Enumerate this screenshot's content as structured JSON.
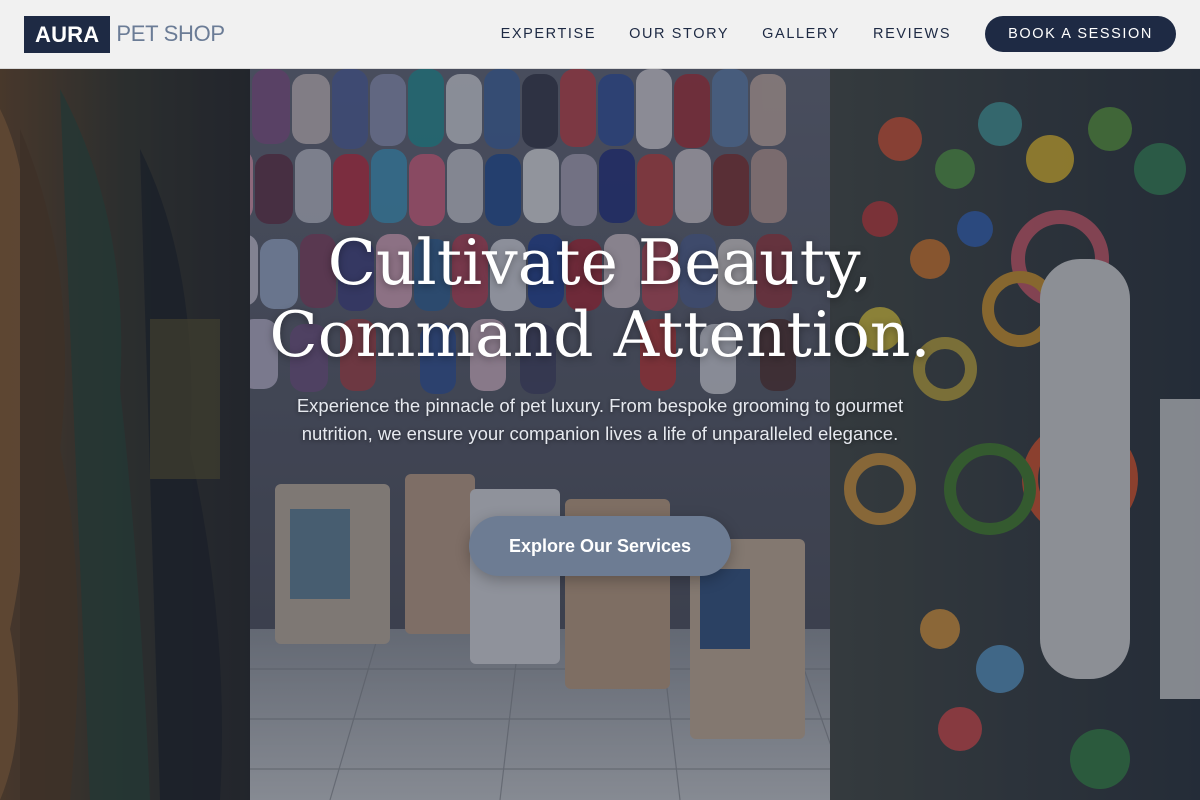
{
  "brand": {
    "box_text": "AURA",
    "rest_text": "PET SHOP"
  },
  "nav": {
    "items": [
      {
        "label": "EXPERTISE"
      },
      {
        "label": "OUR STORY"
      },
      {
        "label": "GALLERY"
      },
      {
        "label": "REVIEWS"
      }
    ],
    "cta_label": "BOOK A SESSION"
  },
  "hero": {
    "title_line1": "Cultivate Beauty,",
    "title_line2": "Command Attention.",
    "subtitle": "Experience the pinnacle of pet luxury. From bespoke grooming to gourmet nutrition, we ensure your companion lives a life of unparalleled elegance.",
    "button_label": "Explore Our Services"
  },
  "colors": {
    "brand_navy": "#1e2a44",
    "brand_slate": "#6b7c96",
    "button_slate": "#6d7c93",
    "header_bg": "#f1f1f1"
  }
}
